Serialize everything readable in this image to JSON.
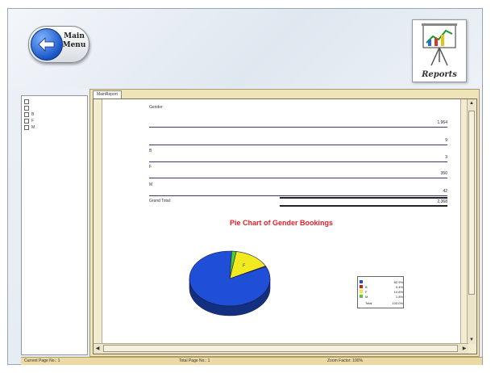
{
  "header": {
    "main_menu_label_line1": "Main",
    "main_menu_label_line2": "Menu",
    "reports_label": "Reports"
  },
  "tree": {
    "items": [
      "",
      "",
      "B",
      "F",
      "M"
    ]
  },
  "viewer": {
    "tab_label": "MainReport"
  },
  "report": {
    "group_header": "Gender",
    "rows": [
      {
        "label": "",
        "value": "1,964"
      },
      {
        "label": "",
        "value": "9"
      },
      {
        "label": "B",
        "value": "3"
      },
      {
        "label": "F",
        "value": "350"
      },
      {
        "label": "M",
        "value": "42"
      }
    ],
    "grand_total_label": "Grand Total:",
    "grand_total_value": "2,368",
    "chart_title": "Pie Chart of Gender Bookings"
  },
  "chart_data": {
    "type": "pie",
    "title": "Pie Chart of Gender Bookings",
    "slices": [
      {
        "name": "",
        "value": 82.9,
        "color": "#1f4fd6",
        "display": "82.9%"
      },
      {
        "name": "B",
        "value": 0.4,
        "color": "#c8202a",
        "display": "0.4%"
      },
      {
        "name": "F",
        "value": 14.8,
        "color": "#f2ea20",
        "display": "14.8%"
      },
      {
        "name": "M",
        "value": 1.8,
        "color": "#4fcf2e",
        "display": "1.8%"
      }
    ],
    "slice_label": "F",
    "legend_total_label": "Total",
    "legend_total_value": "100.0%",
    "legend_position": "right"
  },
  "status": {
    "current_page": "Current Page No.: 1",
    "total_page": "Total Page No.: 1",
    "zoom": "Zoom Factor: 100%"
  }
}
